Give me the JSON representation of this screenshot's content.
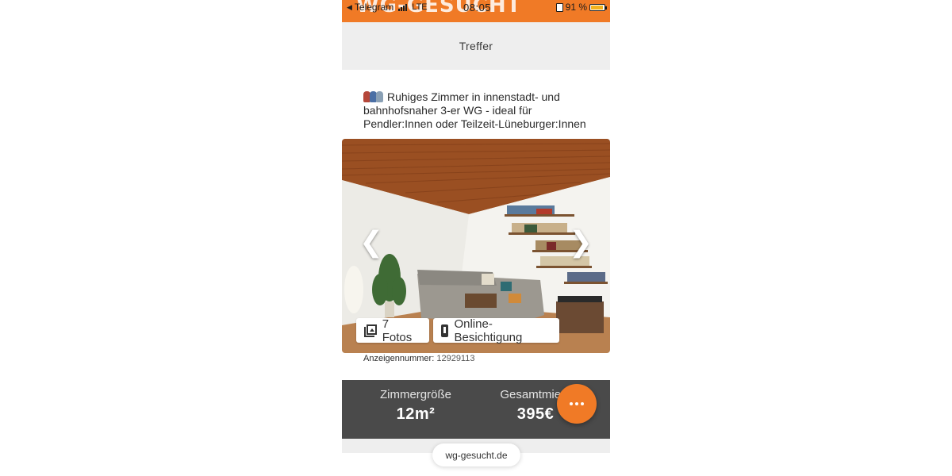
{
  "status_bar": {
    "back_app": "Telegram",
    "network": "LTE",
    "time": "08:05",
    "battery": "91 %",
    "battery_level": 0.91,
    "background_watermark": "WG-GESUCHT"
  },
  "header": {
    "title": "Treffer"
  },
  "listing": {
    "title": "Ruhiges Zimmer in innenstadt- und bahnhofsnaher 3-er WG - ideal für Pendler:Innen oder Teilzeit-Lüneburger:Innen",
    "people_icon": "flatmates-icon",
    "gallery": {
      "prev_glyph": "❮",
      "next_glyph": "❯",
      "photos_label": "7 Fotos",
      "tour_label": "Online-Besichtigung"
    },
    "ad_number_label": "Anzeigennummer:",
    "ad_number": "12929113"
  },
  "stats": {
    "size_label": "Zimmergröße",
    "size_value": "12m²",
    "rent_label": "Gesamtmiete",
    "rent_value": "395€"
  },
  "browser": {
    "url": "wg-gesucht.de"
  },
  "colors": {
    "accent": "#f07a26",
    "stats_bg": "#4a4a4a",
    "header_bg": "#eeeeee"
  }
}
